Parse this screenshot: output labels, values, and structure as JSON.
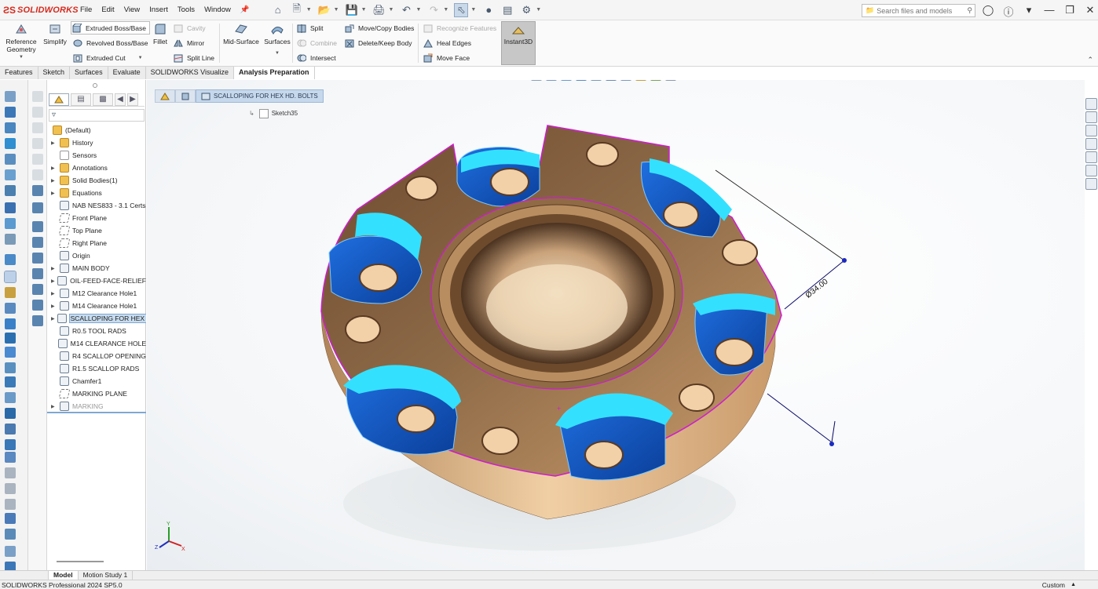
{
  "app": {
    "brand": "SOLIDWORKS",
    "menu": [
      "File",
      "Edit",
      "View",
      "Insert",
      "Tools",
      "Window"
    ],
    "search_placeholder": "Search files and models"
  },
  "ribbon": {
    "reference_geometry": "Reference Geometry",
    "simplify": "Simplify",
    "extruded_boss": "Extruded Boss/Base",
    "revolved_boss": "Revolved Boss/Base",
    "extruded_cut": "Extruded Cut",
    "fillet": "Fillet",
    "cavity": "Cavity",
    "mirror": "Mirror",
    "split_line": "Split Line",
    "mid_surface": "Mid-Surface",
    "surfaces": "Surfaces",
    "split": "Split",
    "combine": "Combine",
    "intersect": "Intersect",
    "move_copy_bodies": "Move/Copy Bodies",
    "delete_keep_body": "Delete/Keep Body",
    "recognize_features": "Recognize Features",
    "heal_edges": "Heal Edges",
    "move_face": "Move Face",
    "instant3d": "Instant3D"
  },
  "tabs": [
    {
      "label": "Features",
      "active": false
    },
    {
      "label": "Sketch",
      "active": false
    },
    {
      "label": "Surfaces",
      "active": false
    },
    {
      "label": "Evaluate",
      "active": false
    },
    {
      "label": "SOLIDWORKS Visualize",
      "active": false
    },
    {
      "label": "Analysis Preparation",
      "active": true
    }
  ],
  "tree": {
    "root": "(Default)",
    "items": [
      {
        "label": "History",
        "icon": "history-icon",
        "expandable": true
      },
      {
        "label": "Sensors",
        "icon": "sensors-icon",
        "expandable": false
      },
      {
        "label": "Annotations",
        "icon": "annotations-icon",
        "expandable": true
      },
      {
        "label": "Solid Bodies(1)",
        "icon": "solid-bodies-icon",
        "expandable": true
      },
      {
        "label": "Equations",
        "icon": "equations-icon",
        "expandable": true
      },
      {
        "label": "NAB NES833 - 3.1 Certs",
        "icon": "material-icon",
        "expandable": false
      },
      {
        "label": "Front Plane",
        "icon": "plane-icon",
        "expandable": false
      },
      {
        "label": "Top Plane",
        "icon": "plane-icon",
        "expandable": false
      },
      {
        "label": "Right Plane",
        "icon": "plane-icon",
        "expandable": false
      },
      {
        "label": "Origin",
        "icon": "origin-icon",
        "expandable": false
      },
      {
        "label": "MAIN BODY",
        "icon": "feature-icon",
        "expandable": true
      },
      {
        "label": "OIL-FEED-FACE-RELIEF",
        "icon": "feature-icon",
        "expandable": true
      },
      {
        "label": "M12 Clearance Hole1",
        "icon": "hole-icon",
        "expandable": true
      },
      {
        "label": "M14 Clearance Hole1",
        "icon": "hole-icon",
        "expandable": true
      },
      {
        "label": "SCALLOPING FOR HEX HD. BOLTS",
        "icon": "feature-icon",
        "expandable": true,
        "selected": true
      },
      {
        "label": "R0.5 TOOL RADS",
        "icon": "fillet-icon",
        "expandable": false
      },
      {
        "label": "M14 CLEARANCE HOLE",
        "icon": "feature-icon",
        "expandable": false
      },
      {
        "label": "R4 SCALLOP OPENING",
        "icon": "fillet-icon",
        "expandable": false
      },
      {
        "label": "R1.5 SCALLOP RADS",
        "icon": "fillet-icon",
        "expandable": false
      },
      {
        "label": "Chamfer1",
        "icon": "chamfer-icon",
        "expandable": false
      },
      {
        "label": "MARKING PLANE",
        "icon": "plane-icon",
        "expandable": false
      },
      {
        "label": "MARKING",
        "icon": "feature-icon",
        "expandable": true,
        "dim": true
      }
    ]
  },
  "breadcrumb": {
    "feature": "SCALLOPING FOR HEX HD. BOLTS",
    "sketch": "Sketch35"
  },
  "viewport": {
    "dimension": "Ø34.00"
  },
  "bottom_tabs": [
    {
      "label": "Model",
      "active": true
    },
    {
      "label": "Motion Study 1",
      "active": false
    }
  ],
  "status": {
    "version": "SOLIDWORKS Professional 2024 SP5.0",
    "units": "Custom"
  },
  "colors": {
    "brand_red": "#d52b1e",
    "bronze": "#a9825a",
    "scallop_cyan": "#2ee6ff",
    "highlight_magenta": "#d01cd0"
  }
}
